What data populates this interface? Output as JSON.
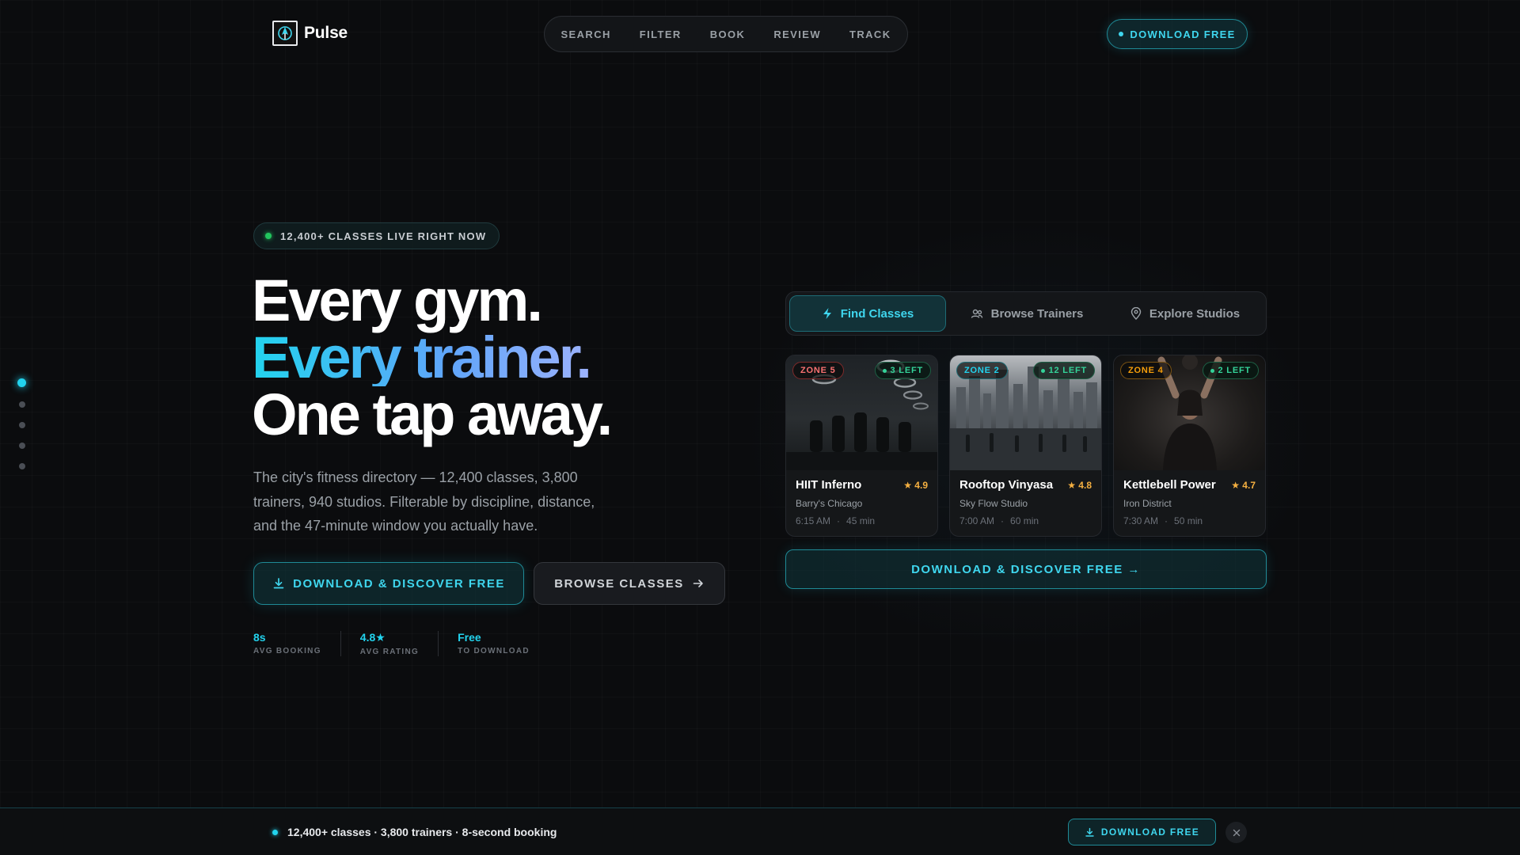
{
  "brand": {
    "name": "Pulse"
  },
  "nav": {
    "items": [
      "SEARCH",
      "FILTER",
      "BOOK",
      "REVIEW",
      "TRACK"
    ]
  },
  "header": {
    "cta_label": "DOWNLOAD FREE"
  },
  "hero": {
    "live_badge": "12,400+ CLASSES LIVE RIGHT NOW",
    "headline_line1": "Every gym.",
    "headline_line2": "Every trainer.",
    "headline_line3": "One tap away.",
    "subtext": "The city's fitness directory — 12,400 classes, 3,800 trainers, 940 studios. Filterable by discipline, distance, and the 47-minute window you actually have.",
    "primary_cta": "DOWNLOAD & DISCOVER FREE",
    "secondary_cta": "BROWSE CLASSES",
    "stats": [
      {
        "value": "8s",
        "label": "AVG BOOKING"
      },
      {
        "value": "4.8★",
        "label": "AVG RATING"
      },
      {
        "value": "Free",
        "label": "TO DOWNLOAD"
      }
    ]
  },
  "pager": {
    "count": 5,
    "active_index": 0
  },
  "panel": {
    "tabs": [
      {
        "label": "Find Classes",
        "icon": "bolt-icon",
        "active": true
      },
      {
        "label": "Browse Trainers",
        "icon": "users-icon",
        "active": false
      },
      {
        "label": "Explore Studios",
        "icon": "map-pin-icon",
        "active": false
      }
    ],
    "cards": [
      {
        "zone": "ZONE 5",
        "spots": "3 LEFT",
        "name": "HIIT Inferno",
        "rating": "★ 4.9",
        "studio": "Barry's Chicago",
        "time": "6:15 AM",
        "duration": "45 min"
      },
      {
        "zone": "ZONE 2",
        "spots": "12 LEFT",
        "name": "Rooftop Vinyasa",
        "rating": "★ 4.8",
        "studio": "Sky Flow Studio",
        "time": "7:00 AM",
        "duration": "60 min"
      },
      {
        "zone": "ZONE 4",
        "spots": "2 LEFT",
        "name": "Kettlebell Power",
        "rating": "★ 4.7",
        "studio": "Iron District",
        "time": "7:30 AM",
        "duration": "50 min"
      }
    ],
    "cta_label": "DOWNLOAD & DISCOVER FREE →"
  },
  "bottom_bar": {
    "text": "12,400+ classes · 3,800 trainers · 8-second booking",
    "cta_label": "DOWNLOAD FREE"
  },
  "colors": {
    "accent": "#22d3ee",
    "live": "#22c55e",
    "zone5": "#f87171",
    "zone4": "#f59e0b",
    "rating": "#f5b041"
  }
}
